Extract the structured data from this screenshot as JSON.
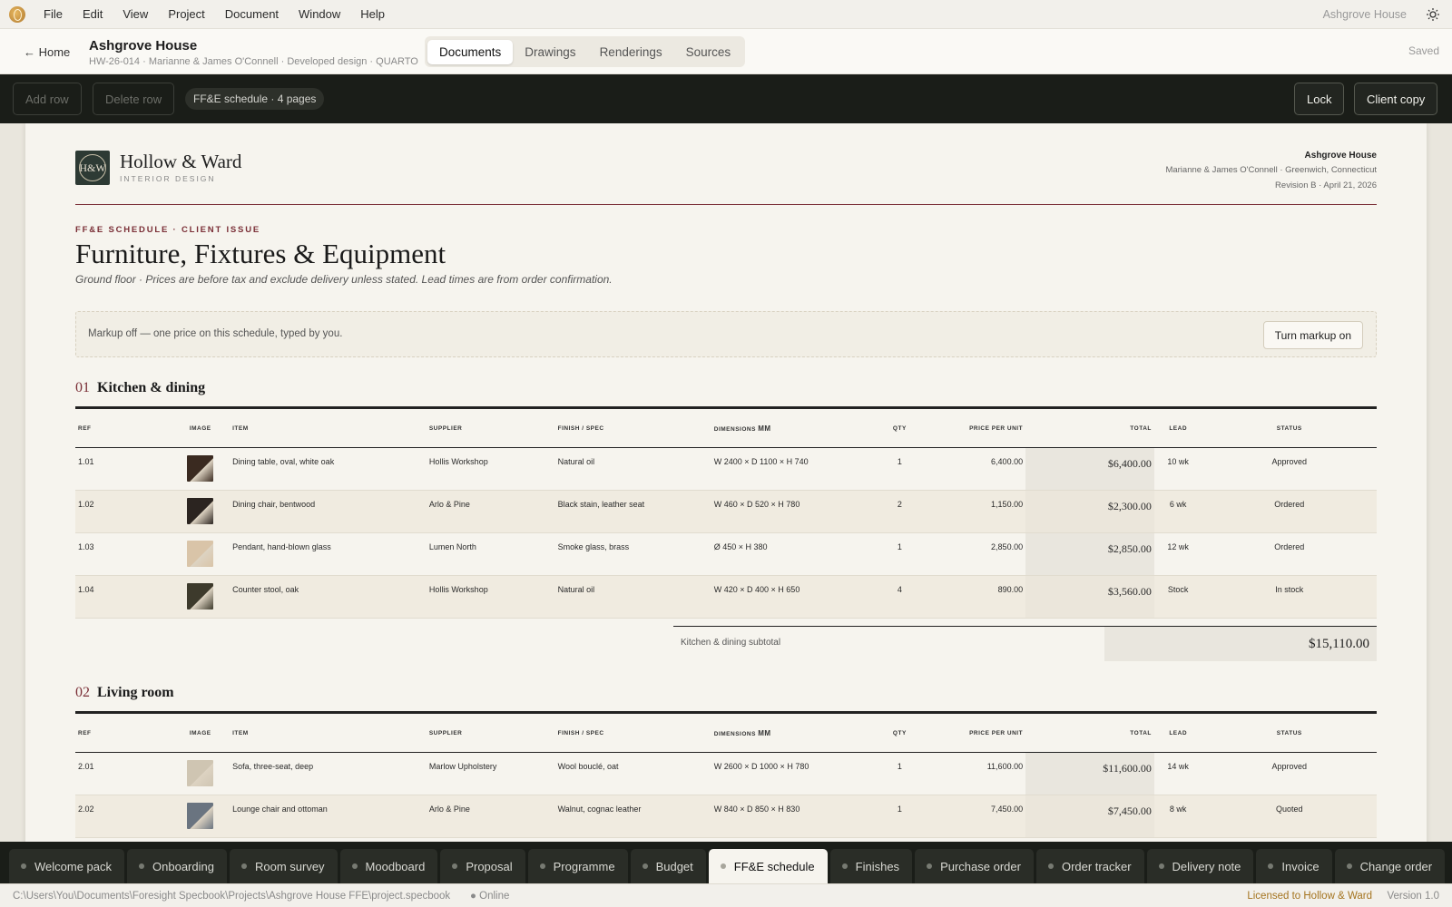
{
  "menubar": {
    "items": [
      "File",
      "Edit",
      "View",
      "Project",
      "Document",
      "Window",
      "Help"
    ],
    "project": "Ashgrove House"
  },
  "header": {
    "home": "← Home",
    "title": "Ashgrove House",
    "meta": "HW-26-014 · Marianne & James O'Connell · Developed design · QUARTO",
    "tabs": [
      "Documents",
      "Drawings",
      "Renderings",
      "Sources"
    ],
    "active_tab": "Documents",
    "saved": "Saved"
  },
  "toolbar": {
    "add_row": "Add row",
    "delete_row": "Delete row",
    "schedule": "FF&E schedule · 4 pages",
    "lock": "Lock",
    "client_copy": "Client copy"
  },
  "doc": {
    "logo": "H&W",
    "brand": "Hollow & Ward",
    "brand_sub": "INTERIOR DESIGN",
    "client_name": "Ashgrove House",
    "client_line": "Marianne & James O'Connell · Greenwich, Connecticut",
    "revision": "Revision B · April 21, 2026",
    "eyebrow": "FF&E SCHEDULE · CLIENT ISSUE",
    "title": "Furniture, Fixtures & Equipment",
    "note": "Ground floor · Prices are before tax and exclude delivery unless stated. Lead times are from order confirmation.",
    "markup_text": "Markup off — one price on this schedule, typed by you.",
    "markup_button": "Turn markup on",
    "columns": {
      "ref": "REF",
      "image": "IMAGE",
      "item": "ITEM",
      "supplier": "SUPPLIER",
      "finish": "FINISH / SPEC",
      "dims_a": "DIMENSIONS",
      "dims_b": "MM",
      "qty": "QTY",
      "price": "PRICE PER UNIT",
      "total": "TOTAL",
      "lead": "LEAD",
      "status": "STATUS"
    },
    "sections": [
      {
        "num": "01",
        "name": "Kitchen & dining",
        "subtotal_label": "Kitchen & dining subtotal",
        "subtotal": "$15,110.00",
        "rows": [
          {
            "ref": "1.01",
            "item": "Dining table, oval, white oak",
            "supplier": "Hollis Workshop",
            "finish": "Natural oil",
            "dims": "W 2400 × D 1100 × H 740",
            "qty": "1",
            "price": "6,400.00",
            "total": "$6,400.00",
            "lead": "10 wk",
            "status": "Approved",
            "thumb": "#3a2a20"
          },
          {
            "ref": "1.02",
            "item": "Dining chair, bentwood",
            "supplier": "Arlo & Pine",
            "finish": "Black stain, leather seat",
            "dims": "W 460 × D 520 × H 780",
            "qty": "2",
            "price": "1,150.00",
            "total": "$2,300.00",
            "lead": "6 wk",
            "status": "Ordered",
            "thumb": "#2b2420"
          },
          {
            "ref": "1.03",
            "item": "Pendant, hand-blown glass",
            "supplier": "Lumen North",
            "finish": "Smoke glass, brass",
            "dims": "Ø 450 × H 380",
            "qty": "1",
            "price": "2,850.00",
            "total": "$2,850.00",
            "lead": "12 wk",
            "status": "Ordered",
            "thumb": "#d9c4a8"
          },
          {
            "ref": "1.04",
            "item": "Counter stool, oak",
            "supplier": "Hollis Workshop",
            "finish": "Natural oil",
            "dims": "W 420 × D 400 × H 650",
            "qty": "4",
            "price": "890.00",
            "total": "$3,560.00",
            "lead": "Stock",
            "status": "In stock",
            "thumb": "#3d3a2c"
          }
        ]
      },
      {
        "num": "02",
        "name": "Living room",
        "rows": [
          {
            "ref": "2.01",
            "item": "Sofa, three-seat, deep",
            "supplier": "Marlow Upholstery",
            "finish": "Wool bouclé, oat",
            "dims": "W 2600 × D 1000 × H 780",
            "qty": "1",
            "price": "11,600.00",
            "total": "$11,600.00",
            "lead": "14 wk",
            "status": "Approved",
            "thumb": "#cfc5b2"
          },
          {
            "ref": "2.02",
            "item": "Lounge chair and ottoman",
            "supplier": "Arlo & Pine",
            "finish": "Walnut, cognac leather",
            "dims": "W 840 × D 850 × H 830",
            "qty": "1",
            "price": "7,450.00",
            "total": "$7,450.00",
            "lead": "8 wk",
            "status": "Quoted",
            "thumb": "#6a7480"
          }
        ]
      }
    ]
  },
  "doctabs": [
    "Welcome pack",
    "Onboarding",
    "Room survey",
    "Moodboard",
    "Proposal",
    "Programme",
    "Budget",
    "FF&E schedule",
    "Finishes",
    "Purchase order",
    "Order tracker",
    "Delivery note",
    "Invoice",
    "Change order"
  ],
  "active_doctab": "FF&E schedule",
  "status": {
    "path": "C:\\Users\\You\\Documents\\Foresight Specbook\\Projects\\Ashgrove House FFE\\project.specbook",
    "online": "● Online",
    "license": "Licensed to Hollow & Ward",
    "version": "Version 1.0"
  }
}
